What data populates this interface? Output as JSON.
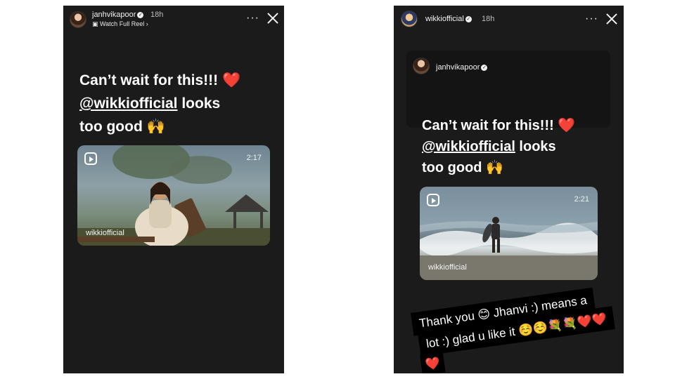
{
  "left_story": {
    "username": "janhvikapoor",
    "time": "18h",
    "subline": "Watch Full Reel",
    "caption_line1": "Can’t wait for this!!! ❤️",
    "caption_mention": "@wikkiofficial",
    "caption_line2_rest": " looks",
    "caption_line3": "too good 🙌",
    "reel": {
      "duration": "2:17",
      "handle": "wikkiofficial"
    }
  },
  "right_story": {
    "username": "wikkiofficial",
    "time": "18h",
    "quoted_username": "janhvikapoor",
    "caption_line1": "Can’t wait for this!!! ❤️",
    "caption_mention": "@wikkiofficial",
    "caption_line2_rest": " looks",
    "caption_line3": "too good 🙌",
    "reel": {
      "duration": "2:21",
      "handle": "wikkiofficial"
    },
    "reply_line1": "Thank you 😊 Jhanvi :) means a",
    "reply_line2": "lot :) glad u like it ☺️☺️💐💐❤️❤️",
    "reply_line3": "❤️"
  },
  "icons": {
    "more": "more-options-icon",
    "close": "close-icon",
    "verified": "verified-badge-icon",
    "reel": "reel-icon"
  },
  "colors": {
    "story_bg": "#1b1b1b",
    "page_bg": "#ffffff"
  }
}
